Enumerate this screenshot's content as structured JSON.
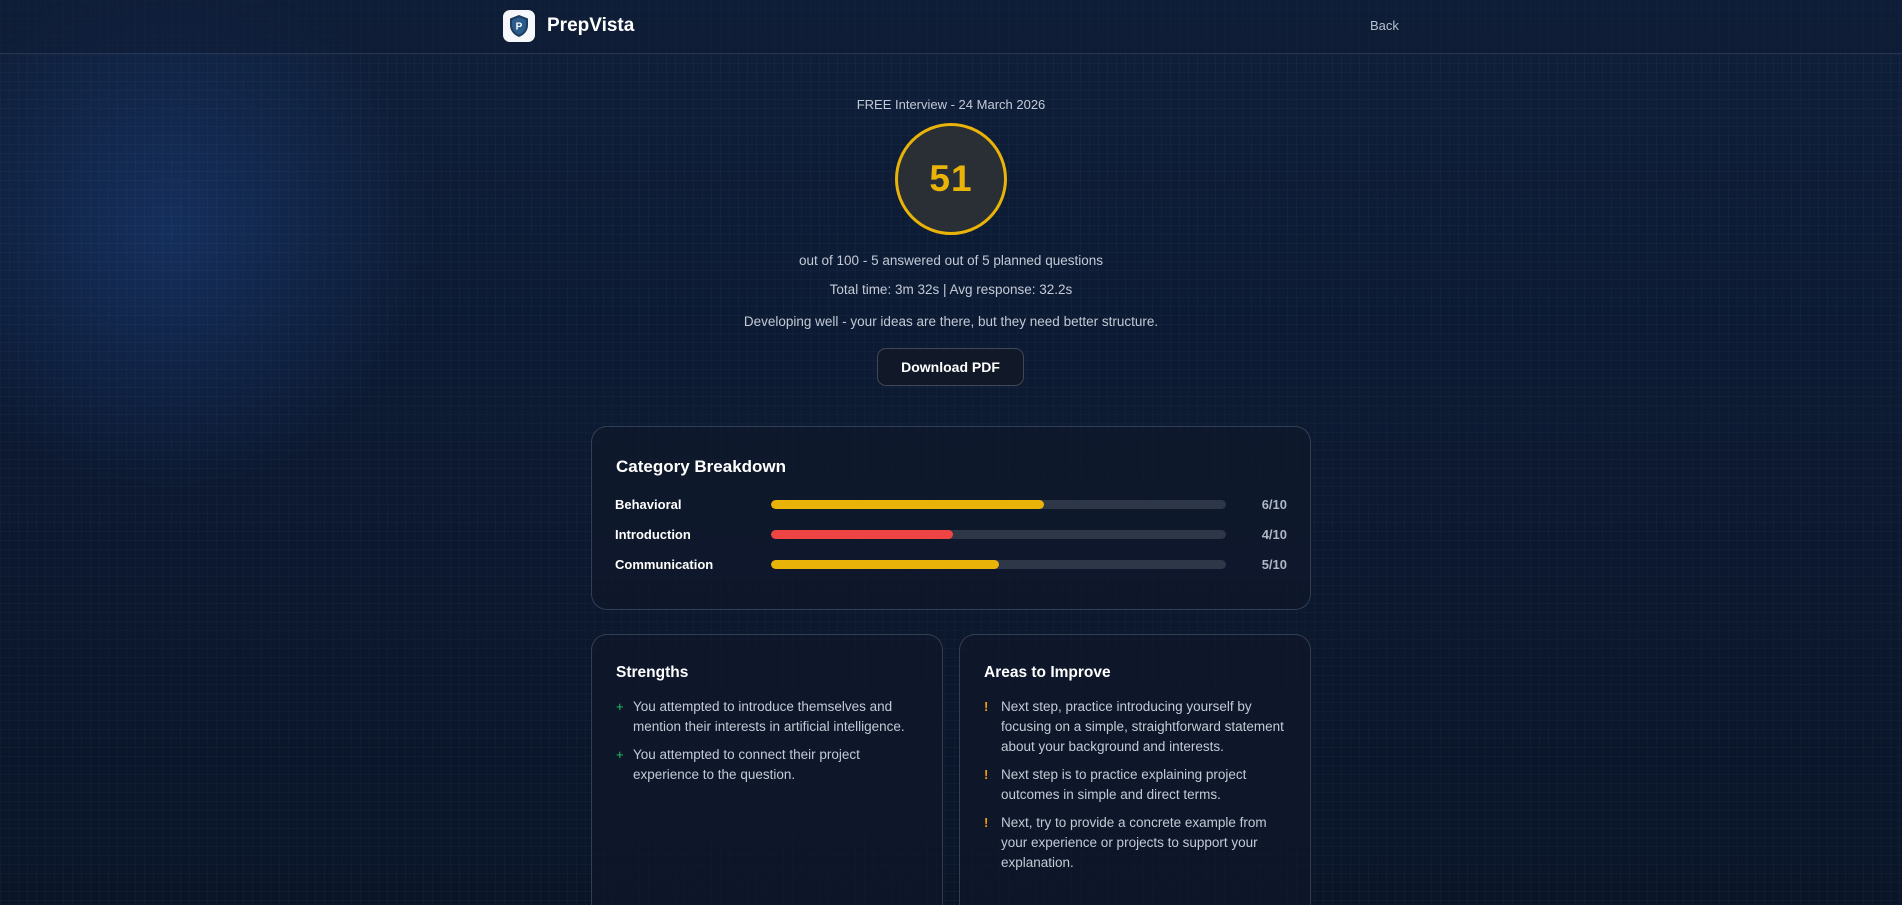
{
  "header": {
    "brand_name": "PrepVista",
    "logo_icon": "shield-logo-icon",
    "back_label": "Back"
  },
  "hero": {
    "subtitle": "FREE Interview - 24 March 2026",
    "score": "51",
    "score_color": "#eab308",
    "summary_line": "out of 100 - 5 answered out of 5 planned questions",
    "time_line": "Total time: 3m 32s | Avg response: 32.2s",
    "feedback_line": "Developing well - your ideas are there, but they need better structure.",
    "download_label": "Download PDF"
  },
  "breakdown": {
    "title": "Category Breakdown",
    "categories": [
      {
        "label": "Behavioral",
        "score_text": "6/10",
        "value": 6,
        "max": 10,
        "color": "#eab308"
      },
      {
        "label": "Introduction",
        "score_text": "4/10",
        "value": 4,
        "max": 10,
        "color": "#ef4444"
      },
      {
        "label": "Communication",
        "score_text": "5/10",
        "value": 5,
        "max": 10,
        "color": "#eab308"
      }
    ]
  },
  "strengths": {
    "title": "Strengths",
    "bullet": "+",
    "items": [
      "You attempted to introduce themselves and mention their interests in artificial intelligence.",
      "You attempted to connect their project experience to the question."
    ]
  },
  "improve": {
    "title": "Areas to Improve",
    "bullet": "!",
    "items": [
      "Next step, practice introducing yourself by focusing on a simple, straightforward statement about your background and interests.",
      "Next step is to practice explaining project outcomes in simple and direct terms.",
      "Next, try to provide a concrete example from your experience or projects to support your explanation."
    ]
  }
}
